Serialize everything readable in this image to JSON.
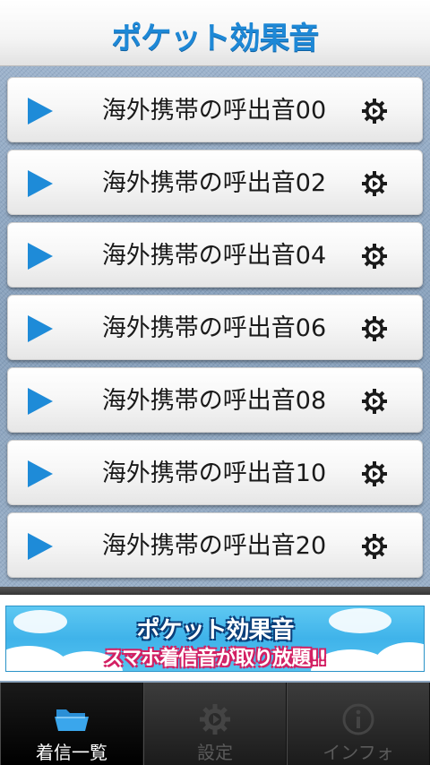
{
  "header": {
    "logo_text": "ポケット効果音"
  },
  "list": {
    "items": [
      {
        "label": "海外携帯の呼出音00"
      },
      {
        "label": "海外携帯の呼出音02"
      },
      {
        "label": "海外携帯の呼出音04"
      },
      {
        "label": "海外携帯の呼出音06"
      },
      {
        "label": "海外携帯の呼出音08"
      },
      {
        "label": "海外携帯の呼出音10"
      },
      {
        "label": "海外携帯の呼出音20"
      }
    ]
  },
  "ad": {
    "title": "ポケット効果音",
    "subtitle": "スマホ着信音が取り放題!!"
  },
  "tabs": [
    {
      "label": "着信一覧",
      "icon": "folder-icon",
      "active": true
    },
    {
      "label": "設定",
      "icon": "gear-icon",
      "active": false
    },
    {
      "label": "インフォ",
      "icon": "info-icon",
      "active": false
    }
  ],
  "colors": {
    "accent": "#1e8bd8",
    "tab_active_label": "#ffffff",
    "tab_inactive_label": "#5a5a5a"
  }
}
